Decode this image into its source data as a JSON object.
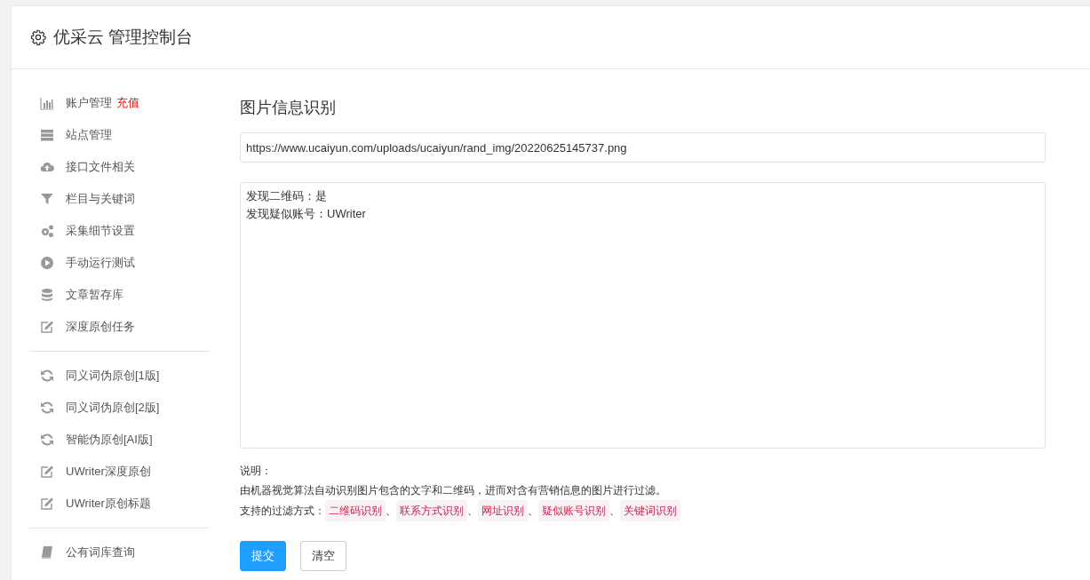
{
  "header": {
    "title": "优采云 管理控制台"
  },
  "sidebar": {
    "sections": [
      {
        "items": [
          {
            "kind": "chart",
            "label": "账户管理",
            "badge": "充值"
          },
          {
            "kind": "server",
            "label": "站点管理"
          },
          {
            "kind": "cloud",
            "label": "接口文件相关"
          },
          {
            "kind": "filter",
            "label": "栏目与关键词"
          },
          {
            "kind": "gears",
            "label": "采集细节设置"
          },
          {
            "kind": "play",
            "label": "手动运行测试"
          },
          {
            "kind": "database",
            "label": "文章暂存库"
          },
          {
            "kind": "edit",
            "label": "深度原创任务"
          }
        ]
      },
      {
        "items": [
          {
            "kind": "refresh",
            "label": "同义词伪原创[1版]"
          },
          {
            "kind": "refresh",
            "label": "同义词伪原创[2版]"
          },
          {
            "kind": "refresh",
            "label": "智能伪原创[AI版]"
          },
          {
            "kind": "edit",
            "label": "UWriter深度原创"
          },
          {
            "kind": "edit",
            "label": "UWriter原创标题"
          }
        ]
      },
      {
        "items": [
          {
            "kind": "book",
            "label": "公有词库查询"
          }
        ]
      }
    ]
  },
  "main": {
    "title": "图片信息识别",
    "url_field": {
      "value": "https://www.ucaiyun.com/uploads/ucaiyun/rand_img/20220625145737.png"
    },
    "result_field": {
      "lines": [
        "发现二维码：是",
        "发现疑似账号：UWriter"
      ]
    },
    "notes": {
      "heading": "说明：",
      "description": "由机器视觉算法自动识别图片包含的文字和二维码，进而对含有营销信息的图片进行过滤。",
      "methods_label": "支持的过滤方式：",
      "methods": [
        {
          "label": "二维码识别",
          "separator": "、"
        },
        {
          "label": "联系方式识别",
          "separator": "、"
        },
        {
          "label": "网址识别",
          "separator": "、"
        },
        {
          "label": "疑似账号识别",
          "separator": "、"
        },
        {
          "label": "关键词识别"
        }
      ]
    },
    "buttons": [
      {
        "kind": "primary",
        "label": "提交"
      },
      {
        "kind": "secondary",
        "label": "清空"
      }
    ]
  }
}
